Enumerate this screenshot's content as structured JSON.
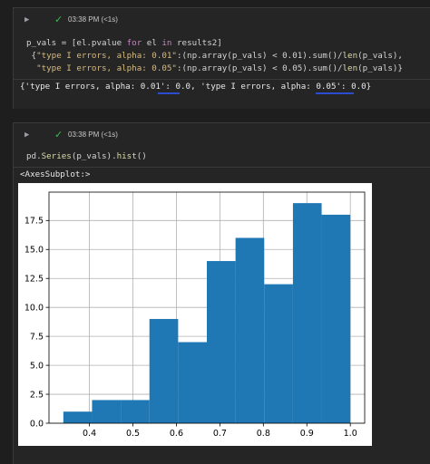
{
  "cell1": {
    "run_icon": "▶",
    "status_icon": "✓",
    "exec_time": "03:38 PM (<1s)",
    "code_lines": [
      [
        [
          "p_vals = [el.pvalue ",
          "var"
        ],
        [
          "for",
          "kw"
        ],
        [
          " el ",
          "var"
        ],
        [
          "in",
          "kw"
        ],
        [
          " results2]",
          "var"
        ]
      ],
      [
        [
          " {",
          "var"
        ],
        [
          "\"type I errors, alpha: 0.01\"",
          "str"
        ],
        [
          ":(np.array(p_vals) < 0.01).sum()/",
          "var"
        ],
        [
          "len",
          "fn"
        ],
        [
          "(p_vals),",
          "var"
        ]
      ],
      [
        [
          "  ",
          "var"
        ],
        [
          "\"type I errors, alpha: 0.05\"",
          "str"
        ],
        [
          ":(np.array(p_vals) < 0.05).sum()/",
          "var"
        ],
        [
          "len",
          "fn"
        ],
        [
          "(p_vals)}",
          "var"
        ]
      ]
    ],
    "output": "{'type I errors, alpha: 0.01': 0.0, 'type I errors, alpha: 0.05': 0.0}"
  },
  "cell2": {
    "run_icon": "▶",
    "status_icon": "✓",
    "exec_time": "03:38 PM (<1s)",
    "code_lines": [
      [
        [
          "pd.",
          "var"
        ],
        [
          "Series",
          "fn"
        ],
        [
          "(p_vals).",
          "var"
        ],
        [
          "hist",
          "fn"
        ],
        [
          "()",
          "var"
        ]
      ]
    ],
    "output": "<AxesSubplot:>"
  },
  "chart_data": {
    "type": "bar",
    "title": "",
    "xlabel": "",
    "ylabel": "",
    "bin_edges": [
      0.34,
      0.406,
      0.472,
      0.538,
      0.604,
      0.67,
      0.736,
      0.802,
      0.868,
      0.934,
      1.0
    ],
    "values": [
      1,
      2,
      2,
      9,
      7,
      14,
      16,
      12,
      19,
      18
    ],
    "xlim": [
      0.307,
      1.033
    ],
    "ylim": [
      0,
      19.95
    ],
    "xticks": [
      "0.4",
      "0.5",
      "0.6",
      "0.7",
      "0.8",
      "0.9",
      "1.0"
    ],
    "yticks": [
      "0.0",
      "2.5",
      "5.0",
      "7.5",
      "10.0",
      "12.5",
      "15.0",
      "17.5"
    ],
    "grid": true,
    "bar_color": "#1f77b4"
  }
}
